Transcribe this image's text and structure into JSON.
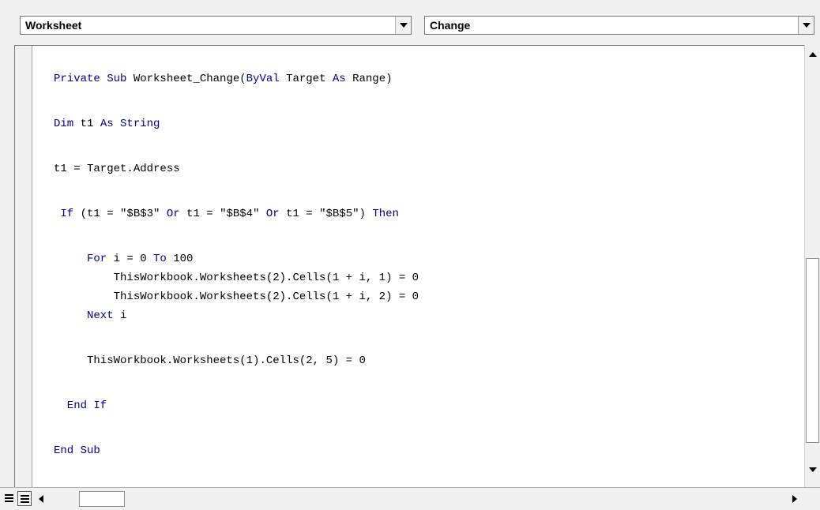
{
  "object_dropdown": {
    "value": "Worksheet",
    "icon": "chevron-down-icon"
  },
  "procedure_dropdown": {
    "value": "Change",
    "icon": "chevron-down-icon"
  },
  "code": {
    "lines": [
      [
        {
          "t": "Private Sub ",
          "k": true
        },
        {
          "t": "Worksheet_Change(",
          "k": false
        },
        {
          "t": "ByVal",
          "k": true
        },
        {
          "t": " Target ",
          "k": false
        },
        {
          "t": "As",
          "k": true
        },
        {
          "t": " Range)",
          "k": false
        }
      ],
      [
        {
          "t": "Dim",
          "k": true
        },
        {
          "t": " t1 ",
          "k": false
        },
        {
          "t": "As String",
          "k": true
        }
      ],
      [
        {
          "t": "t1 = Target.Address",
          "k": false
        }
      ],
      [
        {
          "t": " If",
          "k": true
        },
        {
          "t": " (t1 = \"$B$3\" ",
          "k": false
        },
        {
          "t": "Or",
          "k": true
        },
        {
          "t": " t1 = \"$B$4\" ",
          "k": false
        },
        {
          "t": "Or",
          "k": true
        },
        {
          "t": " t1 = \"$B$5\") ",
          "k": false
        },
        {
          "t": "Then",
          "k": true
        }
      ],
      [
        {
          "t": "     For",
          "k": true
        },
        {
          "t": " i = 0 ",
          "k": false
        },
        {
          "t": "To",
          "k": true
        },
        {
          "t": " 100",
          "k": false
        }
      ],
      [
        {
          "t": "         ThisWorkbook.Worksheets(2).Cells(1 + i, 1) = 0",
          "k": false
        }
      ],
      [
        {
          "t": "         ThisWorkbook.Worksheets(2).Cells(1 + i, 2) = 0",
          "k": false
        }
      ],
      [
        {
          "t": "     Next",
          "k": true
        },
        {
          "t": " i",
          "k": false
        }
      ],
      [
        {
          "t": "     ThisWorkbook.Worksheets(1).Cells(2, 5) = 0",
          "k": false
        }
      ],
      [
        {
          "t": "  End If",
          "k": true
        }
      ],
      [
        {
          "t": "End Sub",
          "k": true
        }
      ]
    ]
  },
  "scrollbar": {
    "vertical_up": "triangle-up-icon",
    "vertical_down": "triangle-down-icon",
    "horizontal_left": "triangle-left-icon",
    "horizontal_right": "triangle-right-icon"
  },
  "view_buttons": {
    "procedure_view": "procedure-view-icon",
    "full_module_view": "full-module-view-icon"
  },
  "colors": {
    "keyword": "#00008b",
    "text": "#000000",
    "background": "#ffffff",
    "chrome": "#f0f0f0"
  }
}
